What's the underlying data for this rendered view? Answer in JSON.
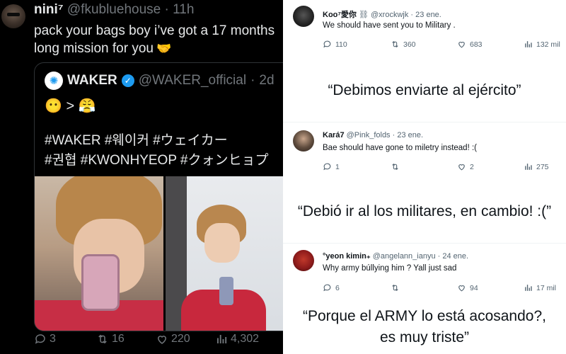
{
  "left_tweet": {
    "author_name": "nini⁷",
    "author_handle": "@fkubluehouse",
    "separator": "·",
    "time": "11h",
    "text": "pack your bags boy i’ve got a 17 months long mission for you",
    "text_emoji": "🤝",
    "quoted": {
      "name": "WAKER",
      "handle": "@WAKER_official",
      "separator": "·",
      "time": "2d",
      "emoji_line": "😶 > 😤",
      "hashtags_line1": "#WAKER #웨이커 #ウェイカー",
      "hashtags_line2": "#권협 #KWONHYEOP #クォンヒョプ"
    },
    "actions": {
      "replies": "3",
      "retweets": "16",
      "likes": "220",
      "views": "4,302"
    }
  },
  "replies": [
    {
      "name": "Koo⁷愛你",
      "badge": "⛓",
      "handle": "@xrockwjk",
      "separator": "·",
      "time": "23 ene.",
      "text": "We should have sent you to Military .",
      "replies": "110",
      "retweets": "360",
      "likes": "683",
      "views": "132 mil",
      "translation": "“Debimos enviarte al ejército”"
    },
    {
      "name": "Kará7",
      "handle": "@Pink_folds",
      "separator": "·",
      "time": "23 ene.",
      "text": "Bae should have gone to miletry instead! :(",
      "replies": "1",
      "retweets": "",
      "likes": "2",
      "views": "275",
      "translation": "“Debió ir al los militares, en cambio! :(”"
    },
    {
      "name": "°yeon kimin",
      "name_suffix": "₊",
      "handle": "@angelann_ianyu",
      "separator": "·",
      "time": "24 ene.",
      "text": "Why army búllying him ? Yall just sad",
      "replies": "6",
      "retweets": "",
      "likes": "94",
      "views": "17 mil",
      "translation": "“Porque el ARMY lo está acosando?, es muy triste”"
    }
  ],
  "colors": {
    "dark_bg": "#000000",
    "dark_text": "#e7e9ea",
    "dark_muted": "#71767b",
    "light_text": "#0f1419",
    "light_muted": "#536471",
    "verified": "#1d9bf0"
  },
  "icons": [
    "reply-icon",
    "retweet-icon",
    "like-icon",
    "views-icon",
    "verified-badge-icon"
  ]
}
